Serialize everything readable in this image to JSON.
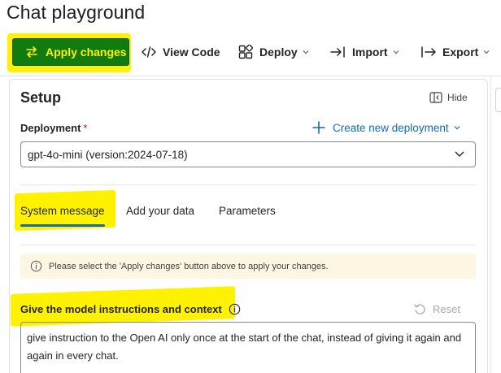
{
  "page": {
    "title": "Chat playground"
  },
  "toolbar": {
    "apply_label": "Apply changes",
    "view_code_label": "View Code",
    "deploy_label": "Deploy",
    "import_label": "Import",
    "export_label": "Export",
    "icons": {
      "apply": "arrows-swap-icon",
      "view_code": "code-icon",
      "deploy": "cube-icon",
      "import": "arrow-import-icon",
      "export": "arrow-export-icon",
      "chevron": "chevron-down-icon"
    }
  },
  "setup": {
    "title": "Setup",
    "hide_label": "Hide",
    "deployment": {
      "label": "Deployment",
      "required_mark": "*",
      "create_label": "Create new deployment",
      "selected": "gpt-4o-mini (version:2024-07-18)"
    },
    "tabs": [
      {
        "label": "System message",
        "active": true
      },
      {
        "label": "Add your data",
        "active": false
      },
      {
        "label": "Parameters",
        "active": false
      }
    ],
    "notice": "Please select the 'Apply changes' button above to apply your changes.",
    "instructions": {
      "label": "Give the model instructions and context",
      "reset_label": "Reset",
      "value": "give instruction to the Open AI only once at the start of the chat, instead of giving it again and again in every chat."
    }
  },
  "colors": {
    "apply_bg": "#107c10",
    "highlight": "#fff200",
    "accent": "#0f6cbd",
    "required": "#c50f1f",
    "notice_bg": "#fdf6e3"
  }
}
